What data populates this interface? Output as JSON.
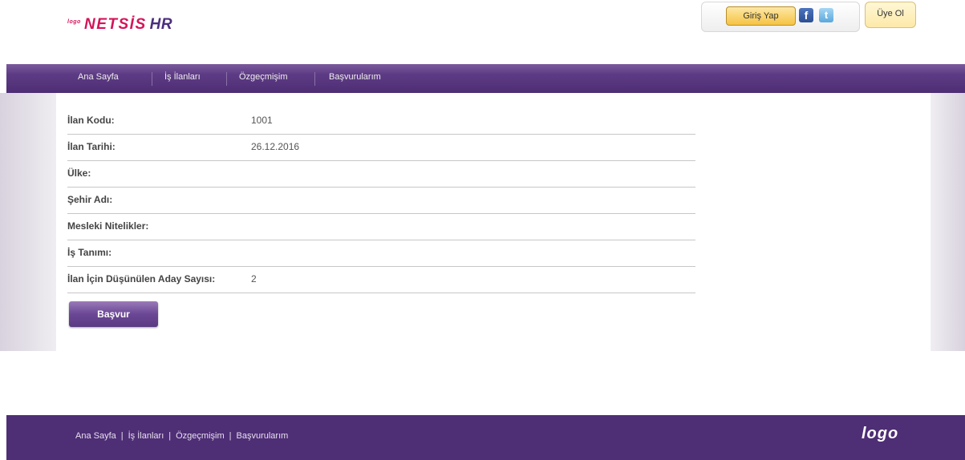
{
  "header": {
    "logo_small": "logo",
    "logo_brand": "NETSİS",
    "logo_hr": "HR",
    "login_label": "Giriş Yap",
    "facebook_glyph": "f",
    "twitter_glyph": "t",
    "signup_label": "Üye Ol"
  },
  "nav": {
    "items": [
      {
        "label": "Ana Sayfa"
      },
      {
        "label": "İş İlanları"
      },
      {
        "label": "Özgeçmişim"
      },
      {
        "label": "Başvurularım"
      }
    ]
  },
  "details": {
    "rows": [
      {
        "label": "İlan Kodu:",
        "value": "1001"
      },
      {
        "label": "İlan Tarihi:",
        "value": "26.12.2016"
      },
      {
        "label": "Ülke:",
        "value": ""
      },
      {
        "label": "Şehir Adı:",
        "value": ""
      },
      {
        "label": "Mesleki Nitelikler:",
        "value": ""
      },
      {
        "label": "İş Tanımı:",
        "value": ""
      },
      {
        "label": "İlan İçin Düşünülen Aday Sayısı:",
        "value": "2"
      }
    ],
    "apply_label": "Başvur"
  },
  "footer": {
    "links": [
      {
        "label": "Ana Sayfa"
      },
      {
        "label": "İş İlanları"
      },
      {
        "label": "Özgeçmişim"
      },
      {
        "label": "Başvurularım"
      }
    ],
    "separator": "|",
    "logo": "logo"
  },
  "colors": {
    "brand_purple": "#4e2e75",
    "logo_pink": "#d4145a",
    "login_yellow": "#f6c343"
  }
}
